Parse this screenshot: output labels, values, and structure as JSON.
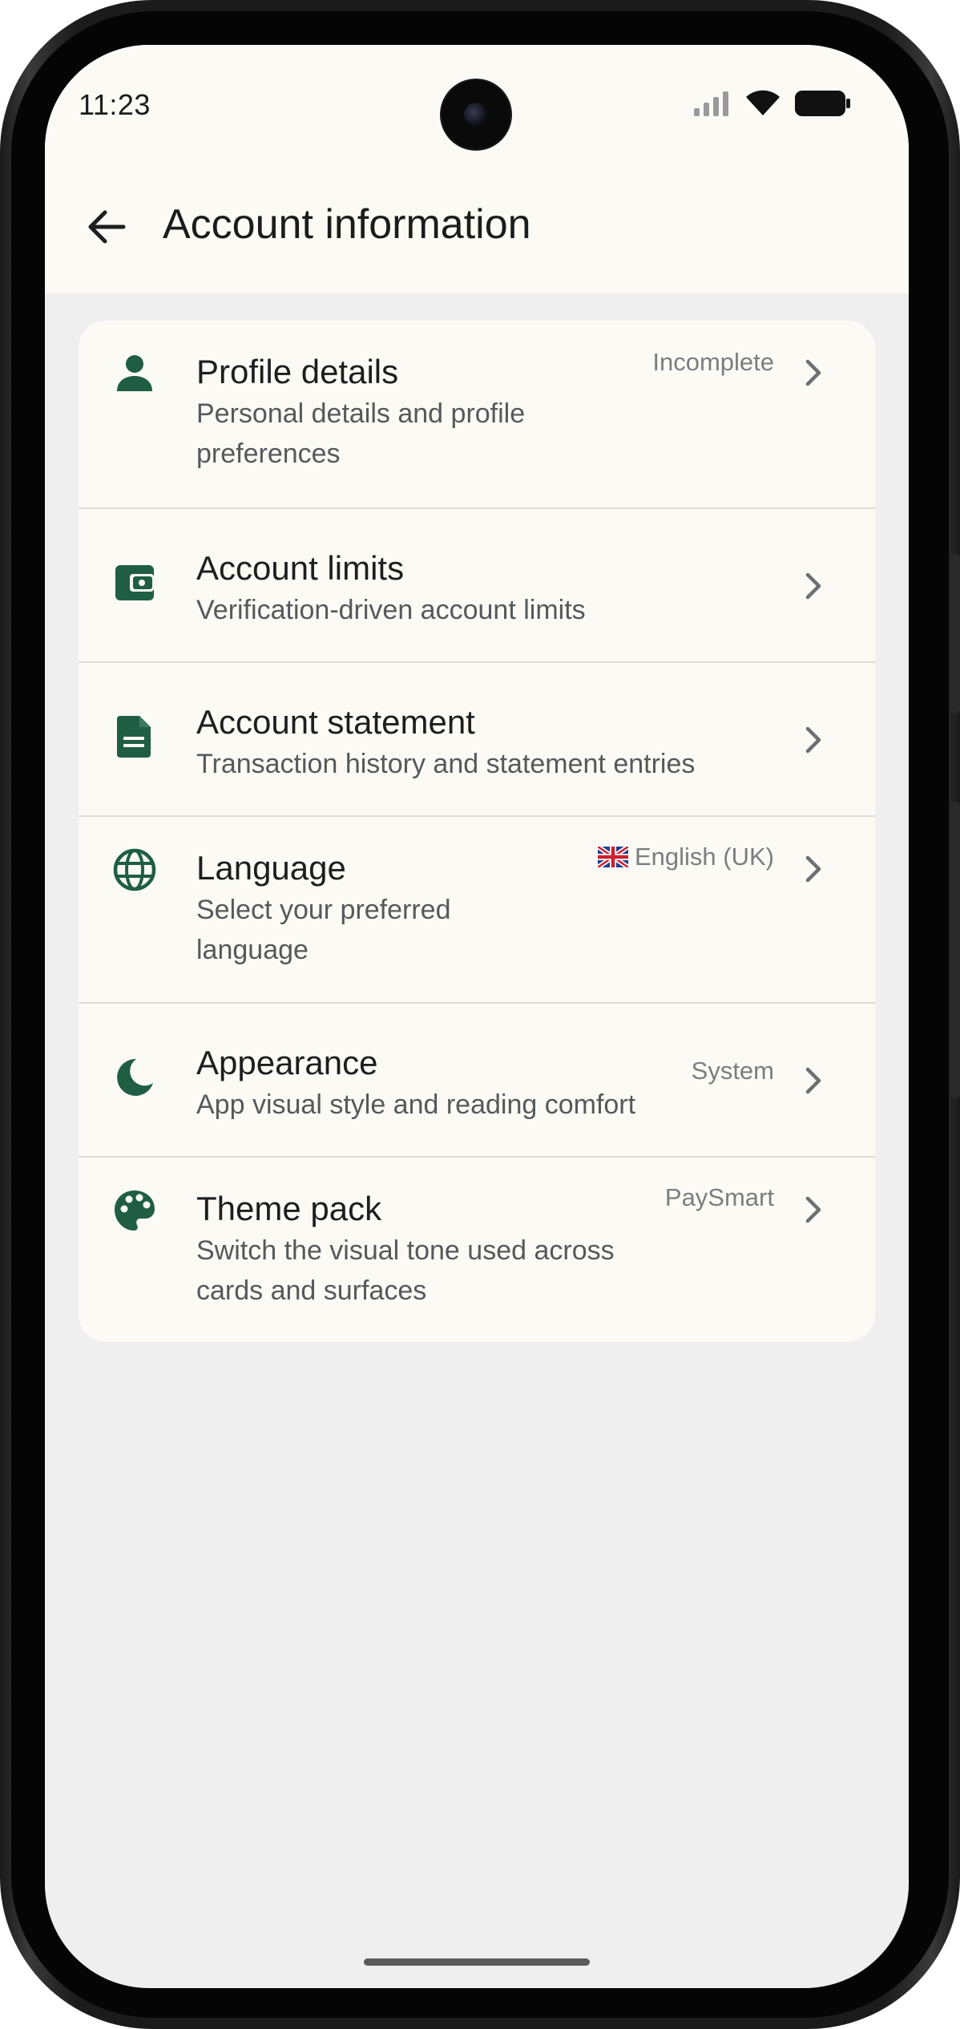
{
  "status_bar": {
    "time": "11:23"
  },
  "header": {
    "title": "Account information"
  },
  "rows": [
    {
      "title": "Profile details",
      "subtitle_lines": [
        "Personal details and profile",
        "preferences"
      ],
      "value": "Incomplete",
      "icon": "person-icon"
    },
    {
      "title": "Account limits",
      "subtitle_lines": [
        "Verification-driven account limits"
      ],
      "value": "",
      "icon": "wallet-icon"
    },
    {
      "title": "Account statement",
      "subtitle_lines": [
        "Transaction history and statement entries"
      ],
      "value": "",
      "icon": "document-icon"
    },
    {
      "title": "Language",
      "subtitle_lines": [
        "Select your preferred",
        "language"
      ],
      "value": "English (UK)",
      "icon": "globe-icon"
    },
    {
      "title": "Appearance",
      "subtitle_lines": [
        "App visual style and reading comfort"
      ],
      "value": "System",
      "icon": "moon-icon"
    },
    {
      "title": "Theme pack",
      "subtitle_lines": [
        "Switch the visual tone used across",
        "cards and surfaces"
      ],
      "value": "PaySmart",
      "icon": "palette-icon"
    }
  ],
  "colors": {
    "accent": "#1f5e45",
    "header_bg": "#fcfaf5",
    "screen_bg": "#efeff0",
    "card_bg": "#fcfaf5"
  }
}
